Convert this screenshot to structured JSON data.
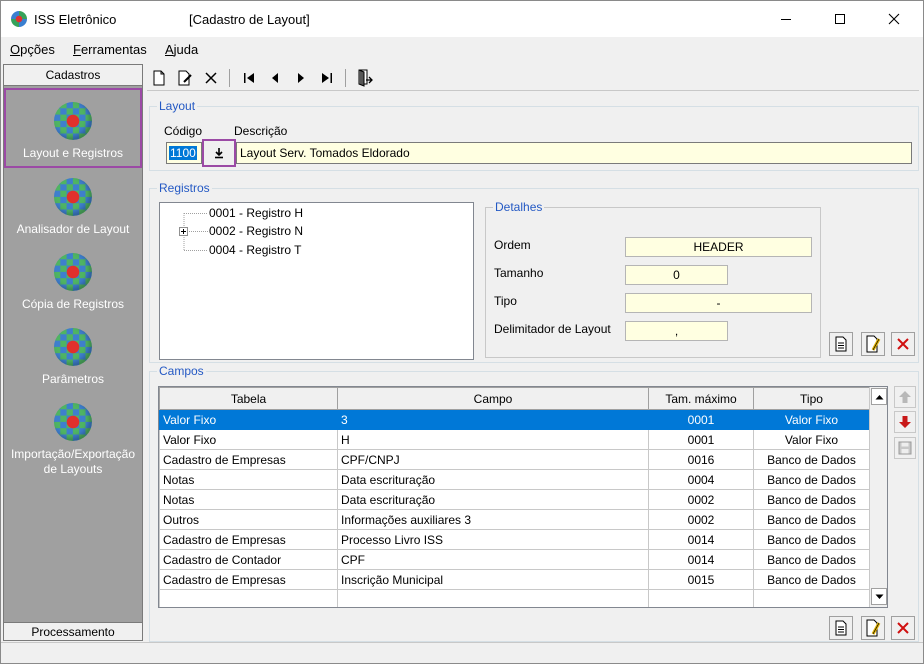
{
  "window": {
    "app_title": "ISS Eletrônico",
    "form_title": "[Cadastro de Layout]"
  },
  "menu": [
    {
      "label": "Opções",
      "accel": "O"
    },
    {
      "label": "Ferramentas",
      "accel": "F"
    },
    {
      "label": "Ajuda",
      "accel": "A"
    }
  ],
  "sidebar": {
    "header": "Cadastros",
    "footer": "Processamento",
    "items": [
      {
        "label": "Layout e Registros",
        "selected": true
      },
      {
        "label": "Analisador de Layout"
      },
      {
        "label": "Cópia de Registros"
      },
      {
        "label": "Parâmetros"
      },
      {
        "label_line1": "Importação/Exportação",
        "label_line2": "de Layouts"
      }
    ]
  },
  "layout": {
    "legend": "Layout",
    "codigo_label": "Código",
    "descricao_label": "Descrição",
    "codigo": "1100",
    "descricao": "Layout Serv. Tomados Eldorado"
  },
  "registros": {
    "legend": "Registros",
    "tree": [
      {
        "label": "0001 - Registro H",
        "expandable": false
      },
      {
        "label": "0002 - Registro N",
        "expandable": true
      },
      {
        "label": "0004 - Registro T",
        "expandable": false
      }
    ],
    "detalhes": {
      "legend": "Detalhes",
      "ordem_label": "Ordem",
      "ordem": "HEADER",
      "tamanho_label": "Tamanho",
      "tamanho": "0",
      "tipo_label": "Tipo",
      "tipo": "-",
      "delimitador_label": "Delimitador de Layout",
      "delimitador": ","
    }
  },
  "campos": {
    "legend": "Campos",
    "columns": [
      "Tabela",
      "Campo",
      "Tam. máximo",
      "Tipo"
    ],
    "rows": [
      [
        "Valor Fixo",
        "3",
        "0001",
        "Valor Fixo"
      ],
      [
        "Valor Fixo",
        "H",
        "0001",
        "Valor Fixo"
      ],
      [
        "Cadastro de Empresas",
        "CPF/CNPJ",
        "0016",
        "Banco de Dados"
      ],
      [
        "Notas",
        "Data escrituração",
        "0004",
        "Banco de Dados"
      ],
      [
        "Notas",
        "Data escrituração",
        "0002",
        "Banco de Dados"
      ],
      [
        "Outros",
        "Informações auxiliares 3",
        "0002",
        "Banco de Dados"
      ],
      [
        "Cadastro de Empresas",
        "Processo Livro ISS",
        "0014",
        "Banco de Dados"
      ],
      [
        "Cadastro de Contador",
        "CPF",
        "0014",
        "Banco de Dados"
      ],
      [
        "Cadastro de Empresas",
        "Inscrição Municipal",
        "0015",
        "Banco de Dados"
      ]
    ],
    "selected_row": 0
  },
  "colors": {
    "accent": "#2459c4",
    "selection": "#0078d7",
    "highlight_border": "#9b4aa5",
    "input_bg": "#ffffe1"
  }
}
